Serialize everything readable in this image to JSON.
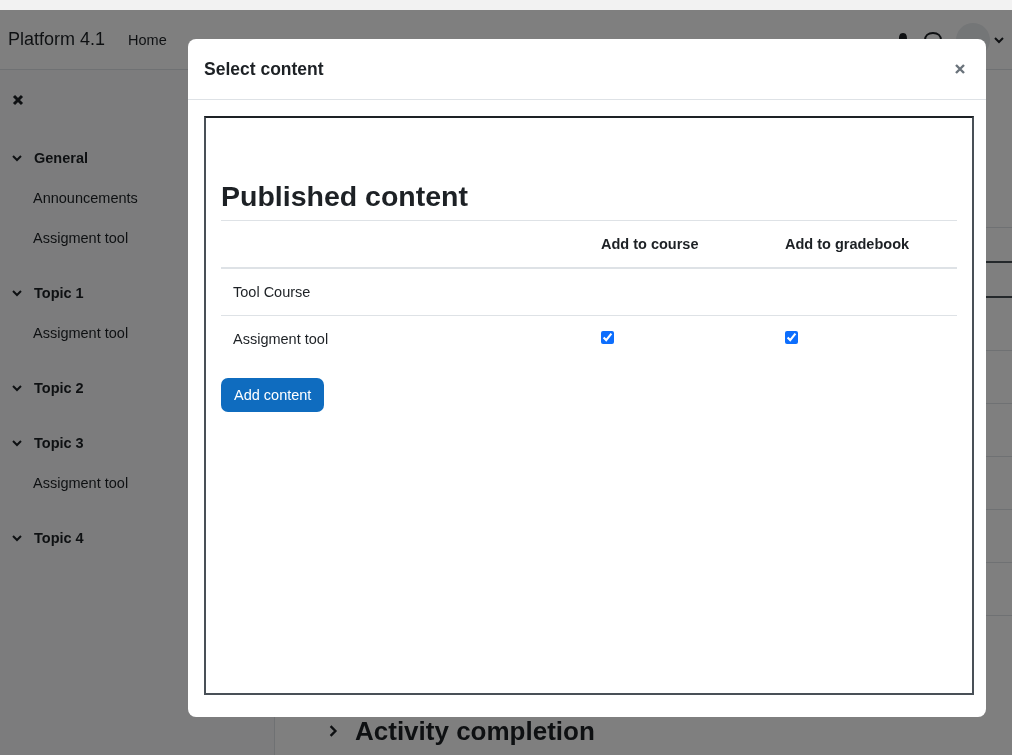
{
  "navbar": {
    "brand": "Platform 4.1",
    "links": [
      "Home"
    ]
  },
  "sidebar": {
    "sections": [
      {
        "title": "General",
        "expanded": true,
        "items": [
          "Announcements",
          "Assigment tool"
        ]
      },
      {
        "title": "Topic 1",
        "expanded": true,
        "items": [
          "Assigment tool"
        ]
      },
      {
        "title": "Topic 2",
        "expanded": true
      },
      {
        "title": "Topic 3",
        "expanded": true,
        "items": [
          "Assigment tool"
        ]
      },
      {
        "title": "Topic 4",
        "expanded": true
      }
    ]
  },
  "main": {
    "section_heading": "Activity completion",
    "expanded": false
  },
  "modal": {
    "title": "Select content",
    "heading": "Published content",
    "columns": [
      "Add to course",
      "Add to gradebook"
    ],
    "rows": [
      {
        "kind": "group",
        "name": "Tool Course"
      },
      {
        "kind": "item",
        "name": "Assigment tool",
        "add_to_course": true,
        "add_to_gradebook": true
      }
    ],
    "button": "Add content"
  }
}
